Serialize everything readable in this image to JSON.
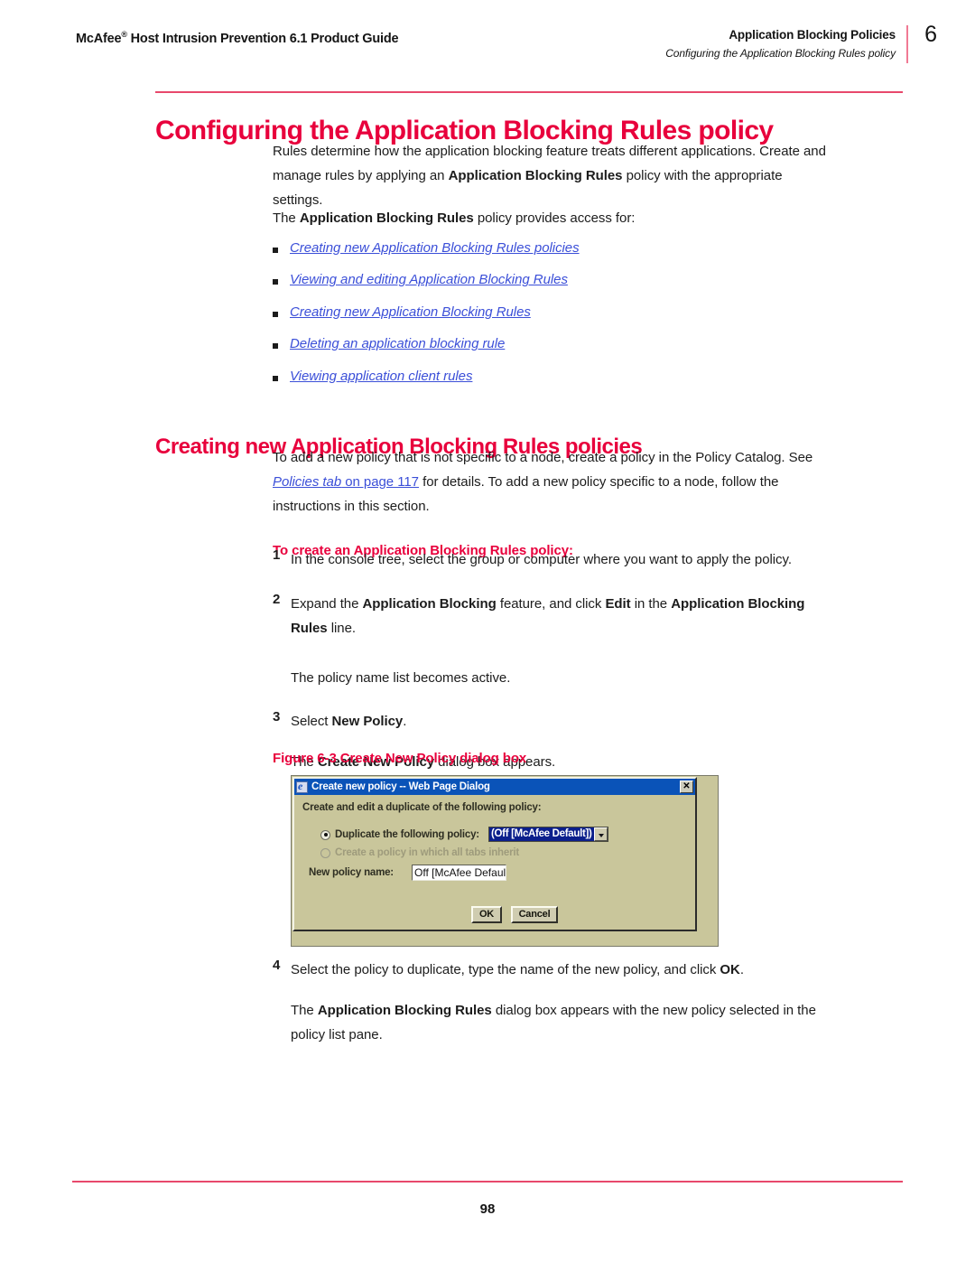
{
  "header": {
    "left_title": "McAfee",
    "left_title_sup": "®",
    "left_title_rest": " Host Intrusion Prevention 6.1 Product Guide",
    "chapter_title": "Application Blocking Policies",
    "section_title": "Configuring the Application Blocking Rules policy",
    "chapter_number": "6"
  },
  "section1": {
    "heading": "Configuring the Application Blocking Rules policy",
    "para1_a": "Rules determine how the application blocking feature treats different applications. Create and manage rules by applying an ",
    "para1_b": "Application Blocking Rules",
    "para1_c": " policy with the appropriate settings.",
    "para2_a": "The ",
    "para2_b": "Application Blocking Rules",
    "para2_c": " policy provides access for:",
    "links": [
      "Creating new Application Blocking Rules policies",
      "Viewing and editing Application Blocking Rules",
      "Creating new Application Blocking Rules",
      "Deleting an application blocking rule",
      "Viewing application client rules"
    ]
  },
  "section2": {
    "heading": "Creating new Application Blocking Rules policies",
    "intro_a": "To add a new policy that is not specific to a node, create a policy in the Policy Catalog. See ",
    "intro_link": "Policies tab",
    "intro_b": " on page 117",
    "intro_c": " for details. To add a new policy specific to a node, follow the instructions in this section.",
    "procedure_title": "To create an Application Blocking Rules policy:",
    "steps": [
      {
        "num": "1",
        "parts": [
          {
            "t": "In the console tree, select the group or computer where you want to apply the policy.",
            "b": false
          }
        ]
      },
      {
        "num": "2",
        "parts": [
          {
            "t": "Expand the ",
            "b": false
          },
          {
            "t": "Application Blocking",
            "b": true
          },
          {
            "t": " feature, and click ",
            "b": false
          },
          {
            "t": "Edit",
            "b": true
          },
          {
            "t": " in the ",
            "b": false
          },
          {
            "t": "Application Blocking Rules",
            "b": true
          },
          {
            "t": " line.",
            "b": false
          }
        ],
        "note": [
          {
            "t": "The policy name list becomes active.",
            "b": false
          }
        ]
      },
      {
        "num": "3",
        "parts": [
          {
            "t": "Select ",
            "b": false
          },
          {
            "t": "New Policy",
            "b": true
          },
          {
            "t": ".",
            "b": false
          }
        ],
        "note": [
          {
            "t": "The ",
            "b": false
          },
          {
            "t": "Create New Policy",
            "b": true
          },
          {
            "t": " dialog box appears.",
            "b": false
          }
        ]
      }
    ],
    "figure_caption": "Figure 6-3  Create New Policy dialog box",
    "steps_after": [
      {
        "num": "4",
        "parts": [
          {
            "t": "Select the policy to duplicate, type the name of the new policy, and click ",
            "b": false
          },
          {
            "t": "OK",
            "b": true
          },
          {
            "t": ".",
            "b": false
          }
        ],
        "note": [
          {
            "t": "The ",
            "b": false
          },
          {
            "t": "Application Blocking Rules",
            "b": true
          },
          {
            "t": " dialog box appears with the new policy selected in the policy list pane.",
            "b": false
          }
        ]
      }
    ]
  },
  "dialog": {
    "title": "Create new policy -- Web Page Dialog",
    "close_label": "✕",
    "prompt": "Create and edit a duplicate of the following policy:",
    "radio1_label": "Duplicate the following policy:",
    "radio2_label": "Create a policy in which all tabs inherit",
    "combo_value": "(Off [McAfee Default])",
    "name_label": "New policy name:",
    "name_value": "Off [McAfee Default]",
    "ok_label": "OK",
    "cancel_label": "Cancel"
  },
  "footer": {
    "page_number": "98"
  },
  "colors": {
    "accent_red": "#e8003c",
    "rule_pink": "#e8486b",
    "link_blue": "#3b4fd8",
    "dialog_bg": "#c9c69b",
    "titlebar_blue": "#0a53b8",
    "combo_select_blue": "#0b1f8c"
  }
}
